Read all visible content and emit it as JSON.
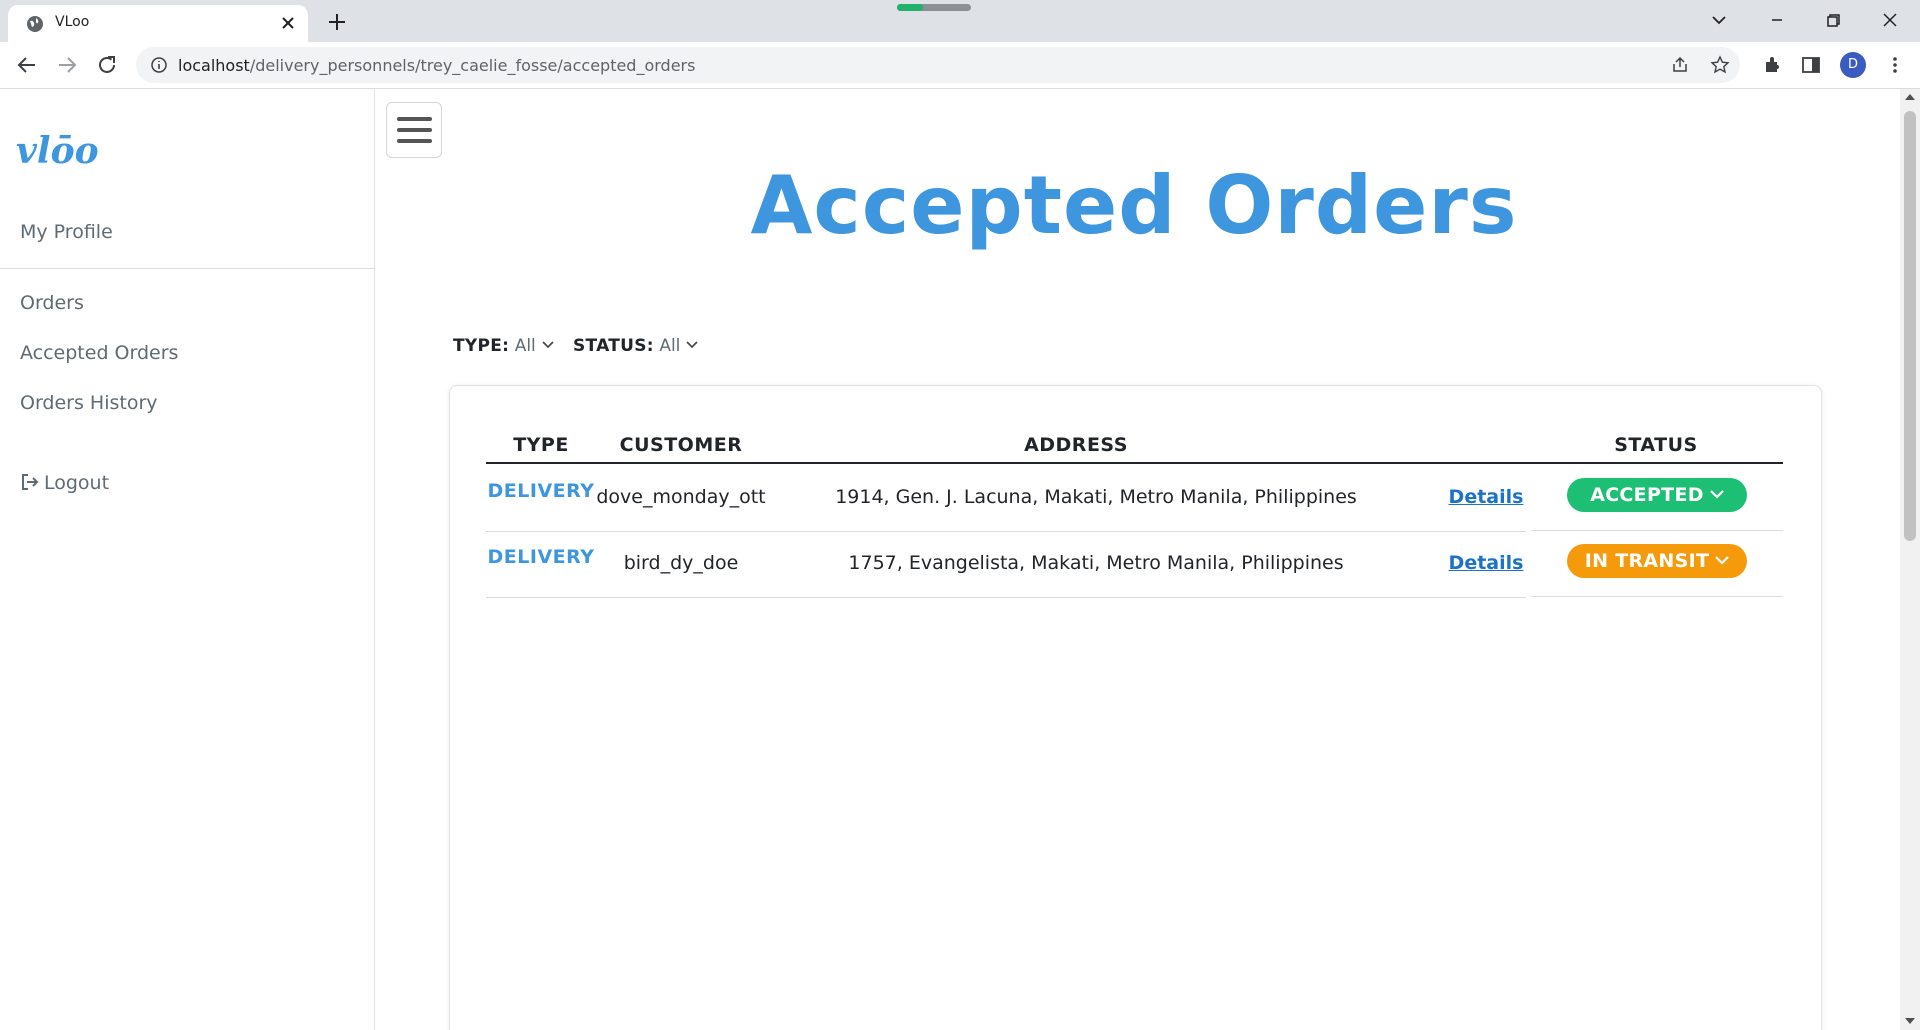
{
  "browser": {
    "tab_title": "VLoo",
    "url_host": "localhost",
    "url_path": "/delivery_personnels/trey_caelie_fosse/accepted_orders",
    "profile_initial": "D",
    "loading_progress": 0.35
  },
  "sidebar": {
    "logo_text": "vlōo",
    "profile_link": "My Profile",
    "items": [
      {
        "label": "Orders"
      },
      {
        "label": "Accepted Orders"
      },
      {
        "label": "Orders History"
      }
    ],
    "logout": "Logout"
  },
  "page": {
    "title": "Accepted Orders"
  },
  "filters": {
    "type_label": "TYPE:",
    "type_value": "All",
    "status_label": "STATUS:",
    "status_value": "All"
  },
  "table": {
    "headers": {
      "type": "TYPE",
      "customer": "CUSTOMER",
      "address": "ADDRESS",
      "status": "STATUS"
    },
    "rows": [
      {
        "type": "DELIVERY",
        "customer": "dove_monday_ott",
        "address": "1914, Gen. J. Lacuna, Makati, Metro Manila, Philippines",
        "details": "Details",
        "status": "ACCEPTED",
        "status_color": "#1cbf73"
      },
      {
        "type": "DELIVERY",
        "customer": "bird_dy_doe",
        "address": "1757, Evangelista, Makati, Metro Manila, Philippines",
        "details": "Details",
        "status": "IN TRANSIT",
        "status_color": "#f59a0b"
      }
    ]
  },
  "colors": {
    "accent": "#3d96de",
    "link": "#1a73c8"
  }
}
